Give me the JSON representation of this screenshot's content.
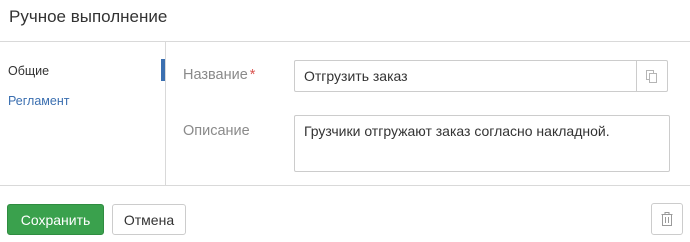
{
  "dialog": {
    "title": "Ручное выполнение"
  },
  "sidebar": {
    "items": [
      {
        "label": "Общие",
        "active": true
      },
      {
        "label": "Регламент",
        "active": false
      }
    ]
  },
  "form": {
    "name": {
      "label": "Название",
      "required_mark": "*",
      "value": "Отгрузить заказ",
      "action_icon": "copy-icon"
    },
    "description": {
      "label": "Описание",
      "value": "Грузчики отгружают заказ согласно накладной."
    }
  },
  "footer": {
    "save_label": "Сохранить",
    "cancel_label": "Отмена",
    "delete_icon": "trash-icon"
  },
  "colors": {
    "accent": "#3b6fb0",
    "primary_button": "#3aa14d",
    "required": "#d9534f"
  }
}
